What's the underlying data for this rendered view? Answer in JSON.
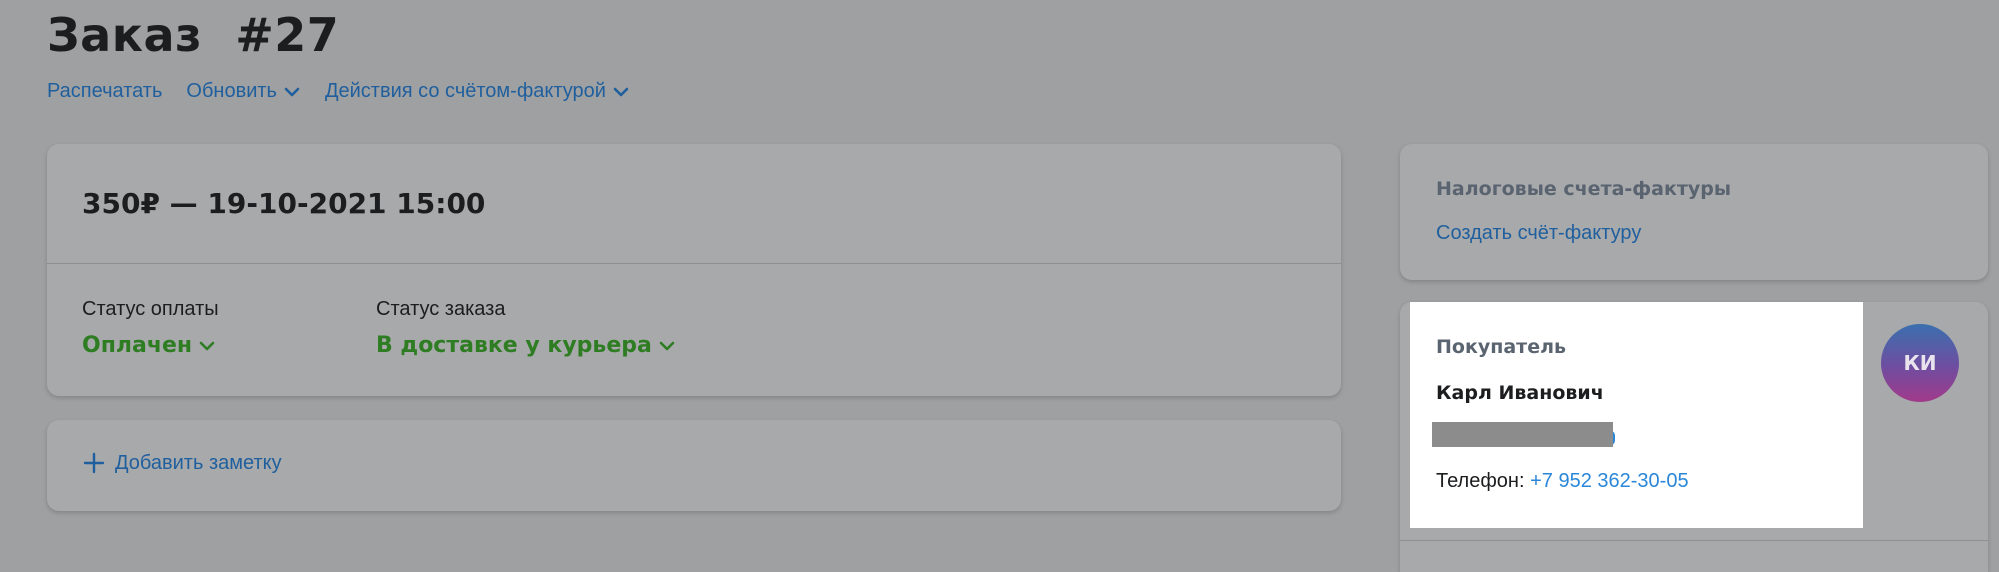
{
  "page": {
    "title": "Заказ  #27"
  },
  "actions": [
    {
      "label": "Распечатать",
      "has_dropdown": false
    },
    {
      "label": "Обновить",
      "has_dropdown": true
    },
    {
      "label": "Действия со счётом-фактурой",
      "has_dropdown": true
    }
  ],
  "order": {
    "summary": "350₽ — 19-10-2021 15:00",
    "payment_status": {
      "label": "Статус оплаты",
      "value": "Оплачен"
    },
    "order_status": {
      "label": "Статус заказа",
      "value": "В доставке у курьера"
    }
  },
  "note": {
    "add_label": "Добавить заметку"
  },
  "tax_invoices": {
    "title": "Налоговые счета-фактуры",
    "create_label": "Создать счёт-фактуру"
  },
  "buyer": {
    "title": "Покупатель",
    "name": "Карл Иванович",
    "phone_label": "Телефон:",
    "phone": "+7 952 362-30-05",
    "avatar_initials": "КИ"
  },
  "colors": {
    "link": "#1f5f9e",
    "status_green": "#2e7d22",
    "phone_link": "#2a86d8"
  }
}
